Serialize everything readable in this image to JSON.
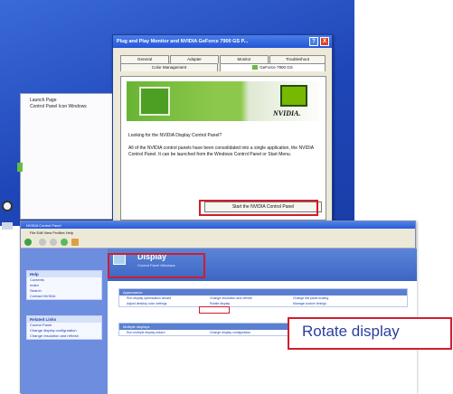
{
  "dialog": {
    "title": "Plug and Play Monitor and NVIDIA GeForce 7900 GS P...",
    "help_glyph": "?",
    "close_glyph": "X",
    "tabs_row1": [
      "General",
      "Adapter",
      "Monitor",
      "Troubleshoot"
    ],
    "tabs_row2": [
      "Color Management",
      "GeForce 7900 GS"
    ],
    "brand": "NVIDIA.",
    "question": "Looking for the NVIDIA Display Control Panel?",
    "paragraph": "All of the NVIDIA control panels have been consolidated into a single application, the NVIDIA Control Panel. It can be launched from the Windows Control Panel or Start Menu.",
    "start_button": "Start the NVIDIA Control Panel"
  },
  "side_menu": {
    "items": [
      "Launch Page",
      "Control Panel Icon Windows"
    ]
  },
  "control_panel": {
    "title": "NVIDIA Control Panel",
    "menu": "File  Edit  View  Profiles  Help",
    "left_sections": [
      {
        "heading": "Help",
        "items": [
          "Contents",
          "Index",
          "Search",
          "Contact NVIDIA"
        ]
      },
      {
        "heading": "Related Links",
        "items": [
          "Control Panel",
          "Change display configuration",
          "Change resolution and refresh"
        ]
      }
    ],
    "header_title": "Display",
    "header_subtitle": "Control Panel Windows",
    "sections": [
      {
        "heading": "Appearance",
        "rows": [
          [
            "Run display optimization wizard",
            "Change resolution and refresh",
            "Change flat panel scaling"
          ],
          [
            "Adjust desktop color settings",
            "Rotate display",
            "Manage custom timings"
          ]
        ]
      },
      {
        "heading": "Multiple displays",
        "rows": [
          [
            "Run multiple display wizard",
            "Change display configuration",
            ""
          ]
        ]
      }
    ]
  },
  "callout": {
    "label": "Rotate display"
  },
  "colors": {
    "highlight": "#d11d2c",
    "nvidia_green": "#76b900",
    "xp_blue": "#2456d8"
  }
}
